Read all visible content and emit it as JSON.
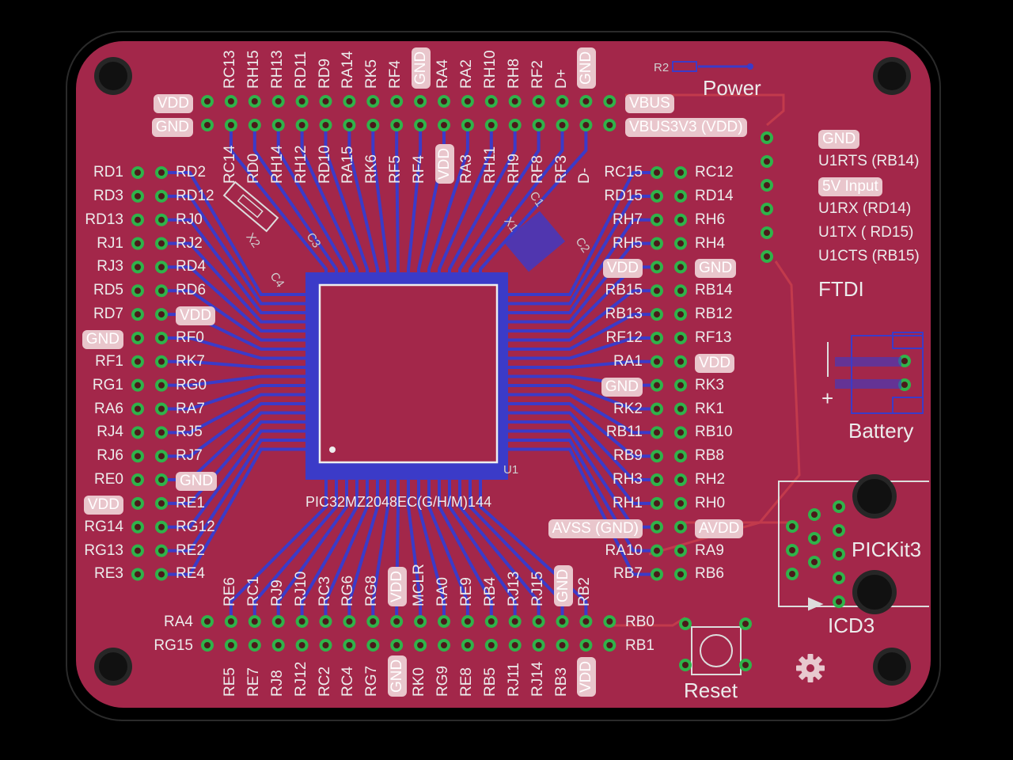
{
  "chip": {
    "name": "PIC32MZ2048EC(G/H/M)144",
    "ref": "U1"
  },
  "top_header": {
    "top_row_labels": [
      "RC13",
      "RH15",
      "RH13",
      "RD11",
      "RD9",
      "RA14",
      "RK5",
      "RF4",
      "GND",
      "RA4",
      "RA2",
      "RH10",
      "RH8",
      "RF2",
      "D+",
      "GND"
    ],
    "bottom_row_labels": [
      "RC14",
      "RD0",
      "RH14",
      "RH12",
      "RD10",
      "RA15",
      "RK6",
      "RF5",
      "RF4",
      "VDD",
      "RA3",
      "RH11",
      "RH9",
      "RF8",
      "RF3",
      "D-"
    ],
    "left_labels": [
      "VDD",
      "GND"
    ],
    "right_labels": [
      "VBUS",
      "VBUS3V3 (VDD)"
    ]
  },
  "left_header": {
    "outer": [
      "RD1",
      "RD3",
      "RD13",
      "RJ1",
      "RJ3",
      "RD5",
      "RD7",
      "GND",
      "RF1",
      "RG1",
      "RA6",
      "RJ4",
      "RJ6",
      "RE0",
      "VDD",
      "RG14",
      "RG13",
      "RE3"
    ],
    "inner": [
      "RD2",
      "RD12",
      "RJ0",
      "RJ2",
      "RD4",
      "RD6",
      "VDD",
      "RF0",
      "RK7",
      "RG0",
      "RA7",
      "RJ5",
      "RJ7",
      "GND",
      "RE1",
      "RG12",
      "RE2",
      "RE4"
    ]
  },
  "right_header": {
    "inner": [
      "RC15",
      "RD15",
      "RH7",
      "RH5",
      "VDD",
      "RB15",
      "RB13",
      "RF12",
      "RA1",
      "GND",
      "RK2",
      "RB11",
      "RB9",
      "RH3",
      "RH1",
      "AVSS (GND)",
      "RA10",
      "RB7"
    ],
    "outer": [
      "RC12",
      "RD14",
      "RH6",
      "RH4",
      "GND",
      "RB14",
      "RB12",
      "RF13",
      "VDD",
      "RK3",
      "RK1",
      "RB10",
      "RB8",
      "RH2",
      "RH0",
      "AVDD",
      "RA9",
      "RB6"
    ]
  },
  "bottom_header": {
    "top_labels": [
      "RE6",
      "RC1",
      "RJ9",
      "RJ10",
      "RC3",
      "RG6",
      "RG8",
      "VDD",
      "MCLR",
      "RA0",
      "RE9",
      "RB4",
      "RJ13",
      "RJ15",
      "GND",
      "RB2"
    ],
    "bottom_labels": [
      "RE5",
      "RE7",
      "RJ8",
      "RJ12",
      "RC2",
      "RC4",
      "RG7",
      "GND",
      "RK0",
      "RG9",
      "RE8",
      "RB5",
      "RJ11",
      "RJ14",
      "RB3",
      "VDD"
    ],
    "left_labels": [
      "RA4",
      "RG15"
    ],
    "right_labels": [
      "RB0",
      "RB1"
    ]
  },
  "ftdi": {
    "title": "FTDI",
    "pins": [
      "GND",
      "U1RTS (RB14)",
      "5V Input",
      "U1RX (RD14)",
      "U1TX ( RD15)",
      "U1CTS (RB15)"
    ]
  },
  "components": {
    "power": "Power",
    "r2": "R2",
    "battery": "Battery",
    "battery_plus": "+",
    "pickit": "PICKit3",
    "icd": "ICD3",
    "reset": "Reset",
    "x1": "X1",
    "x2": "X2",
    "c1": "C1",
    "c2": "C2",
    "c3": "C3",
    "c4": "C4"
  },
  "highlighted": [
    "VDD",
    "GND",
    "VBUS",
    "VBUS3V3 (VDD)",
    "5V Input",
    "AVSS (GND)",
    "AVDD"
  ],
  "colors": {
    "board": "#a3274a",
    "copper": "#3b3bc8",
    "trace_red": "#c23a4c",
    "pad_green": "#2fb34a",
    "pad_hole": "#4a1a1a",
    "highlight_bg": "#e9c6cc",
    "text": "#ececec"
  }
}
